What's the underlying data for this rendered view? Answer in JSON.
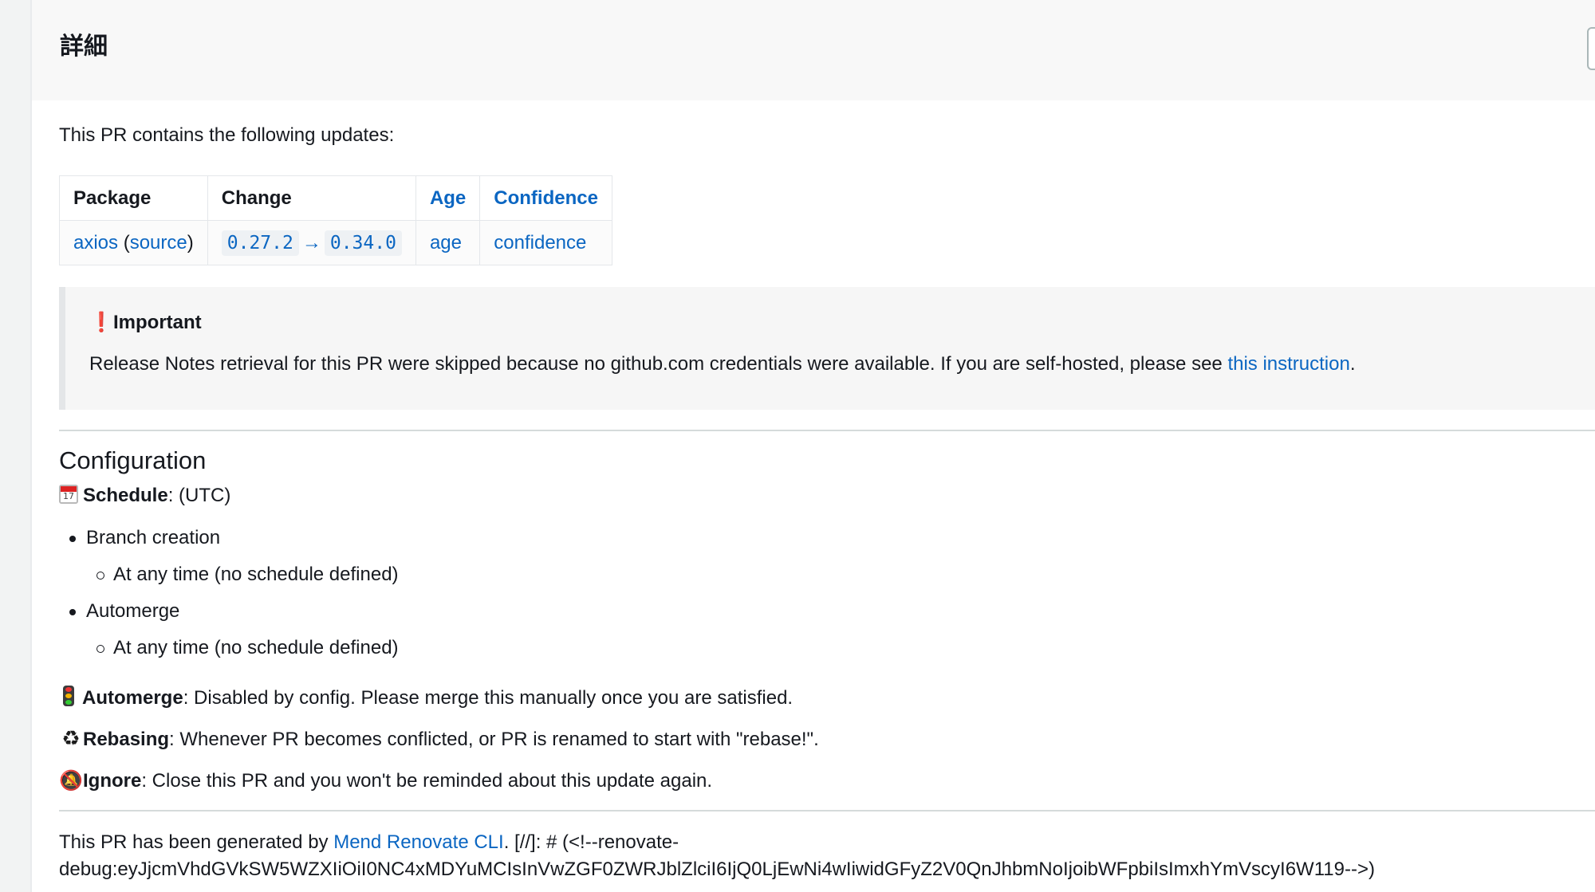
{
  "panel": {
    "title": "詳細"
  },
  "intro": "This PR contains the following updates:",
  "updates_table": {
    "headers": {
      "package": "Package",
      "change": "Change",
      "age": "Age",
      "confidence": "Confidence"
    },
    "row": {
      "package_link": "axios",
      "open_paren": "(",
      "source_link": "source",
      "close_paren": ")",
      "from_version": "0.27.2",
      "arrow": "→",
      "to_version": "0.34.0",
      "age_link": "age",
      "confidence_link": "confidence"
    }
  },
  "callout": {
    "icon": "❗",
    "title": "Important",
    "text": "Release Notes retrieval for this PR were skipped because no github.com credentials were available. If you are self-hosted, please see ",
    "link": "this instruction",
    "period": "."
  },
  "configuration": {
    "heading": "Configuration",
    "calendar_day": "17",
    "schedule_label": "Schedule",
    "schedule_value": ": (UTC)",
    "items": [
      {
        "label": "Branch creation",
        "sub": "At any time (no schedule defined)"
      },
      {
        "label": "Automerge",
        "sub": "At any time (no schedule defined)"
      }
    ],
    "automerge_label": "Automerge",
    "automerge_text": ": Disabled by config. Please merge this manually once you are satisfied.",
    "rebasing_icon": "♻",
    "rebasing_label": "Rebasing",
    "rebasing_text": ": Whenever PR becomes conflicted, or PR is renamed to start with \"rebase!\".",
    "ignore_icon": "🔕",
    "ignore_label": "Ignore",
    "ignore_text": ": Close this PR and you won't be reminded about this update again."
  },
  "footer": {
    "prefix": "This PR has been generated by ",
    "link": "Mend Renovate CLI",
    "suffix": ". [//]: # (<!--renovate-",
    "debug": "debug:eyJjcmVhdGVkSW5WZXIiOiI0NC4xMDYuMCIsInVwZGF0ZWRJblZlciI6IjQ0LjEwNi4wIiwidGFyZ2V0QnJhbmNoIjoibWFpbiIsImxhYmVscyI6W119-->)"
  },
  "colors": {
    "link": "#0b66c2",
    "text": "#16191f",
    "important": "#d91515"
  }
}
